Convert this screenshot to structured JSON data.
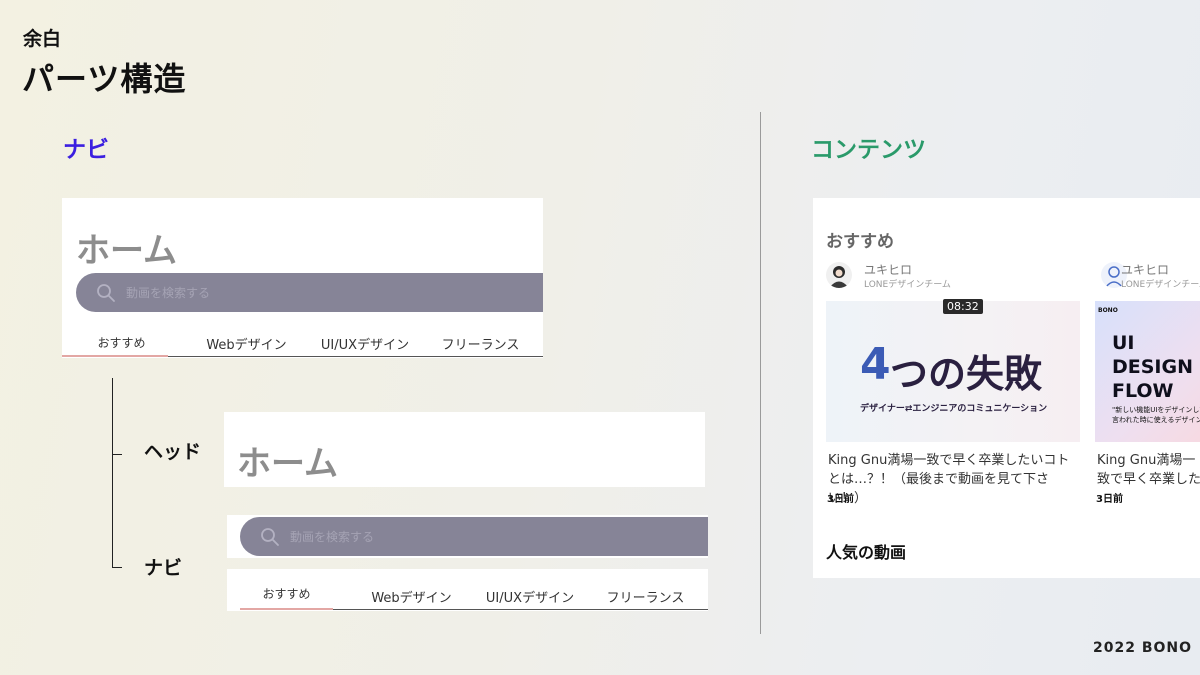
{
  "slide": {
    "subtitle": "余白",
    "title": "パーツ構造",
    "section_nav": "ナビ",
    "section_content": "コンテンツ",
    "footer": "2022 BONO",
    "colors": {
      "nav_heading": "#3b1fe0",
      "content_heading": "#2a9a6a",
      "search_bar": "#868497",
      "active_tab_line": "#e3a7a4"
    }
  },
  "nav_mock": {
    "home": "ホーム",
    "search_placeholder": "動画を検索する",
    "search_icon": "search-icon",
    "tabs": [
      "おすすめ",
      "Webデザイン",
      "UI/UXデザイン",
      "フリーランス"
    ],
    "active_tab": "おすすめ"
  },
  "tree": {
    "head_label": "ヘッド",
    "nav_label": "ナビ"
  },
  "content_mock": {
    "section_title": "おすすめ",
    "videos": [
      {
        "author": "ユキヒロ",
        "team": "LONEデザインチーム",
        "duration": "08:32",
        "thumb_big_num": "4",
        "thumb_big_rest": "つの失敗",
        "thumb_sub": "デザイナー⇄エンジニアのコミュニケーション",
        "title": "King Gnu満場一致で早く卒業したいコトとは…？！（最後まで動画を見て下さい！）",
        "time": "3日前"
      },
      {
        "author": "ユキヒロ",
        "team": "LONEデザインチーム",
        "brand": "BONO",
        "thumb_title": "UI DESIGN FLOW",
        "thumb_sub": "\"新しい機能UIをデザインして\"と言われた時に使えるデザイン",
        "title": "King Gnu満場一致で早く卒業したいコトとは…？！（最後まで動画を見て下さい！）",
        "time": "3日前"
      }
    ],
    "popular_title": "人気の動画"
  }
}
